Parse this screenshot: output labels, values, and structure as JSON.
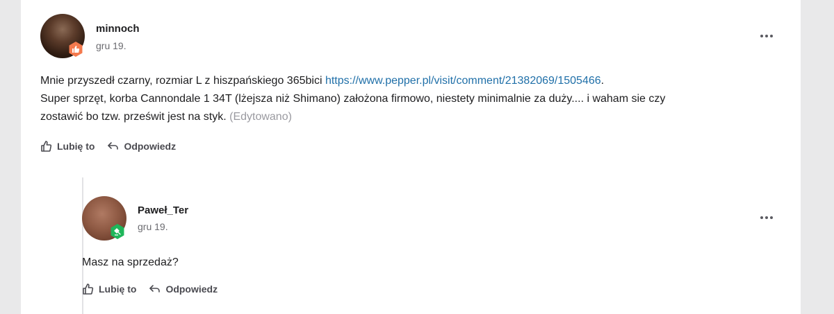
{
  "comments": [
    {
      "username": "minnoch",
      "date": "gru 19.",
      "body_line1_prefix": "Mnie przyszedł czarny, rozmiar L z hiszpańskiego 365bici ",
      "body_link": "https://www.pepper.pl/visit/comment/21382069/1505466",
      "body_line1_suffix": ".",
      "body_line2": "Super sprzęt, korba Cannondale 1 34T (lżejsza niż Shimano) założona firmowo, niestety minimalnie za duży.... i waham sie czy",
      "body_line3": "zostawić bo tzw. prześwit jest na styk.",
      "edited_label": "(Edytowano)",
      "like_label": "Lubię to",
      "reply_label": "Odpowiedz"
    },
    {
      "username": "Paweł_Ter",
      "date": "gru 19.",
      "body": "Masz na sprzedaż?",
      "like_label": "Lubię to",
      "reply_label": "Odpowiedz"
    }
  ],
  "icons": {
    "more": "more-horizontal-icon",
    "like": "thumbs-up-icon",
    "reply": "reply-arrow-icon",
    "badge_top": "thumbs-up-badge-icon",
    "badge_green": "gavel-badge-icon"
  },
  "colors": {
    "link": "#1f6fa8",
    "badge_orange": "#f47a4e",
    "badge_green": "#1fb65a",
    "background": "#e9e9ea"
  }
}
